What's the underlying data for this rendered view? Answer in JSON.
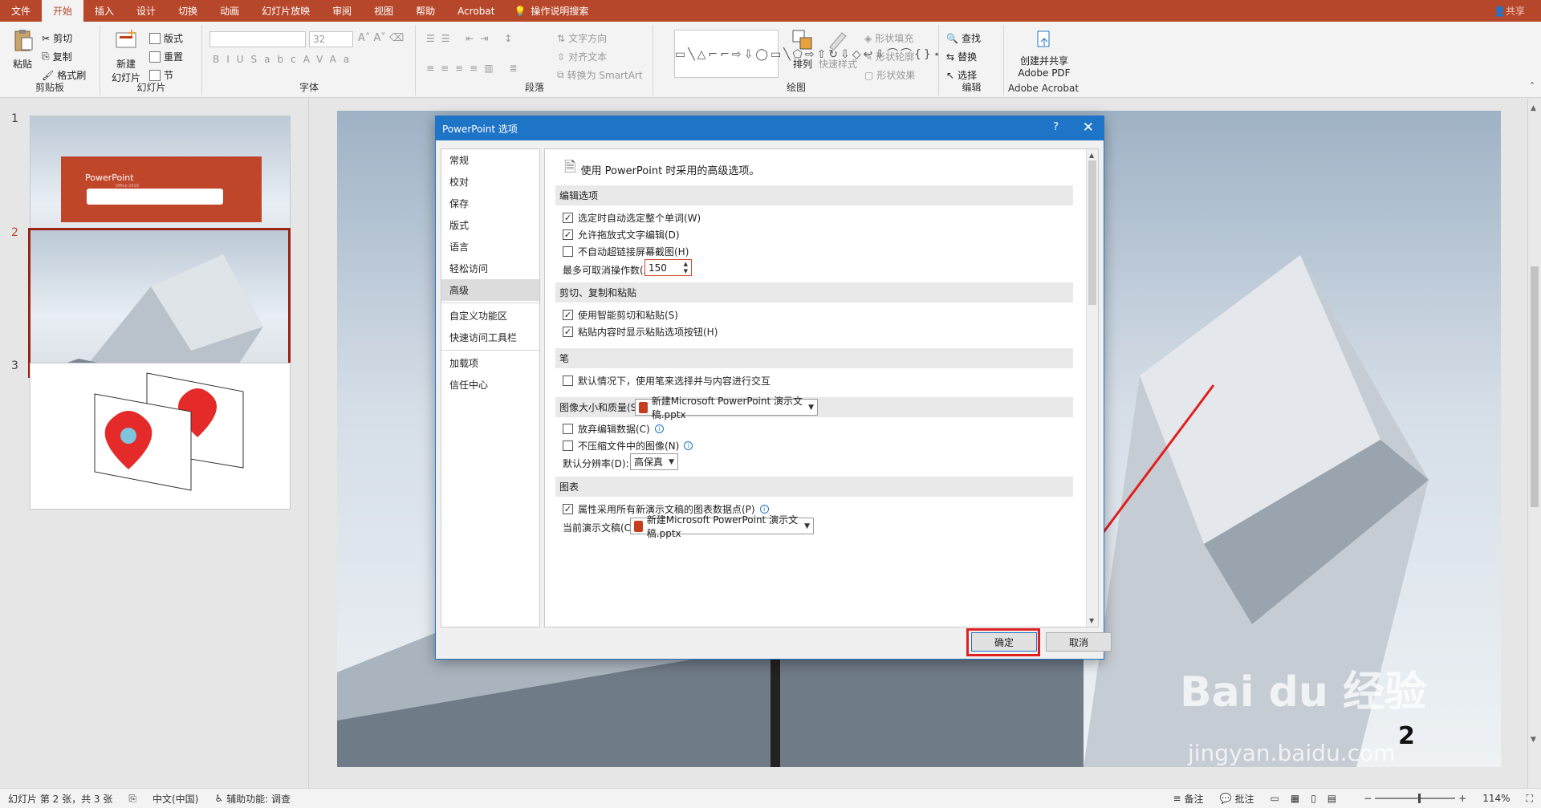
{
  "menu": {
    "tabs": [
      "文件",
      "开始",
      "插入",
      "设计",
      "切换",
      "动画",
      "幻灯片放映",
      "审阅",
      "视图",
      "帮助",
      "Acrobat"
    ],
    "active_tab": "开始",
    "tell_me": "操作说明搜索",
    "share": "共享"
  },
  "ribbon": {
    "clipboard": {
      "paste": "粘贴",
      "cut": "剪切",
      "copy": "复制",
      "format_painter": "格式刷",
      "label": "剪贴板"
    },
    "slides": {
      "new_slide": "新建\n幻灯片",
      "layout": "版式",
      "reset": "重置",
      "section": "节",
      "label": "幻灯片"
    },
    "font": {
      "size": "32",
      "label": "字体"
    },
    "paragraph": {
      "text_direction": "文字方向",
      "align_text": "对齐文本",
      "convert_smartart": "转换为 SmartArt",
      "label": "段落"
    },
    "drawing": {
      "arrange": "排列",
      "quick_styles": "快速样式",
      "shape_fill": "形状填充",
      "shape_outline": "形状轮廓",
      "shape_effects": "形状效果",
      "label": "绘图"
    },
    "editing": {
      "find": "查找",
      "replace": "替换",
      "select": "选择",
      "label": "编辑"
    },
    "acrobat": {
      "create_share": "创建并共享\nAdobe PDF",
      "label": "Adobe Acrobat"
    }
  },
  "slides_panel": {
    "slides": [
      {
        "num": "1",
        "title": "PowerPoint",
        "subtitle": "Office 2019"
      },
      {
        "num": "2",
        "badge": "2"
      },
      {
        "num": "3"
      }
    ],
    "active": "2"
  },
  "slide": {
    "number_label": "2"
  },
  "watermark": {
    "brand": "Bai du 经验",
    "url": "jingyan.baidu.com"
  },
  "dialog": {
    "title": "PowerPoint 选项",
    "help": "?",
    "close": "✕",
    "nav": [
      "常规",
      "校对",
      "保存",
      "版式",
      "语言",
      "轻松访问",
      "高级",
      "自定义功能区",
      "快速访问工具栏",
      "加载项",
      "信任中心"
    ],
    "nav_selected": "高级",
    "header": "使用 PowerPoint 时采用的高级选项。",
    "sections": {
      "editing": "编辑选项",
      "clipboard": "剪切、复制和粘贴",
      "pen": "笔",
      "image": "图像大小和质量(S)",
      "chart": "图表"
    },
    "editing_options": [
      {
        "label": "选定时自动选定整个单词(W)",
        "checked": true
      },
      {
        "label": "允许拖放式文字编辑(D)",
        "checked": true
      },
      {
        "label": "不自动超链接屏幕截图(H)",
        "checked": false
      }
    ],
    "undo_label": "最多可取消操作数(X):",
    "undo_value": "150",
    "clipboard_options": [
      {
        "label": "使用智能剪切和粘贴(S)",
        "checked": true
      },
      {
        "label": "粘贴内容时显示粘贴选项按钮(H)",
        "checked": true
      }
    ],
    "pen_option": {
      "label": "默认情况下，使用笔来选择并与内容进行交互",
      "checked": false
    },
    "image_file": "新建Microsoft PowerPoint 演示文稿.pptx",
    "image_options": [
      {
        "label": "放弃编辑数据(C)",
        "checked": false
      },
      {
        "label": "不压缩文件中的图像(N)",
        "checked": false
      }
    ],
    "resolution_label": "默认分辨率(D):",
    "resolution_value": "高保真",
    "chart_option": {
      "label": "属性采用所有新演示文稿的图表数据点(P)",
      "checked": true
    },
    "current_doc_label": "当前演示文稿(C):",
    "current_doc_value": "新建Microsoft PowerPoint 演示文稿.pptx",
    "ok": "确定",
    "cancel": "取消"
  },
  "status": {
    "slide_info": "幻灯片 第 2 张，共 3 张",
    "language": "中文(中国)",
    "accessibility": "辅助功能: 调查",
    "notes": "备注",
    "comments": "批注",
    "zoom": "114%"
  },
  "colors": {
    "accent": "#b7472a",
    "dialog_title": "#1e74c7",
    "highlight": "#e02020"
  }
}
